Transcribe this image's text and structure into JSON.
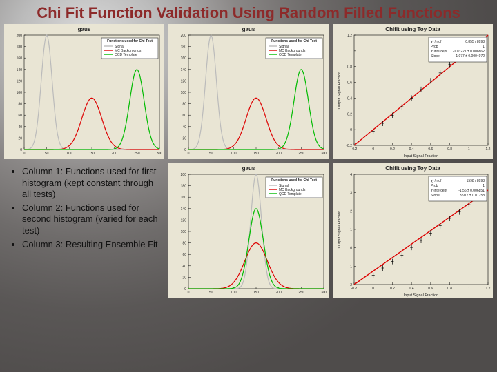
{
  "title": "Chi Fit Function Validation Using Random Filled Functions",
  "bullets": [
    "Column 1: Functions used for first histogram (kept constant through all tests)",
    "Column 2: Functions used for second histogram (varied for each test)",
    "Column 3: Resulting Ensemble Fit"
  ],
  "gaus_legend": {
    "title": "Functions used for Chi Test",
    "items": [
      "Signal",
      "MC Backgrounds",
      "QCD Template"
    ]
  },
  "chart_data": [
    {
      "id": "p1",
      "type": "line",
      "title": "gaus",
      "xlim": [
        0,
        300
      ],
      "ylim": [
        0,
        200
      ],
      "xticks": [
        0,
        50,
        100,
        150,
        200,
        250,
        300
      ],
      "yticks": [
        0,
        20,
        40,
        60,
        80,
        100,
        120,
        140,
        160,
        180,
        200
      ],
      "series": [
        {
          "name": "Signal",
          "color": "#bbb",
          "mu": 50,
          "sigma": 12,
          "amp": 200
        },
        {
          "name": "MC Backgrounds",
          "color": "#d00",
          "mu": 150,
          "sigma": 22,
          "amp": 90
        },
        {
          "name": "QCD Template",
          "color": "#0b0",
          "mu": 250,
          "sigma": 16,
          "amp": 140
        }
      ]
    },
    {
      "id": "p2",
      "type": "line",
      "title": "gaus",
      "xlim": [
        0,
        300
      ],
      "ylim": [
        0,
        200
      ],
      "xticks": [
        0,
        50,
        100,
        150,
        200,
        250,
        300
      ],
      "yticks": [
        0,
        20,
        40,
        60,
        80,
        100,
        120,
        140,
        160,
        180,
        200
      ],
      "series": [
        {
          "name": "Signal",
          "color": "#bbb",
          "mu": 50,
          "sigma": 12,
          "amp": 200
        },
        {
          "name": "MC Backgrounds",
          "color": "#d00",
          "mu": 150,
          "sigma": 22,
          "amp": 90
        },
        {
          "name": "QCD Template",
          "color": "#0b0",
          "mu": 250,
          "sigma": 16,
          "amp": 140
        }
      ]
    },
    {
      "id": "p3",
      "type": "scatter",
      "title": "Chifit using Toy Data",
      "xlabel": "Input Signal Fraction",
      "ylabel": "Output Signal Fraction",
      "xlim": [
        -0.2,
        1.2
      ],
      "ylim": [
        -0.2,
        1.2
      ],
      "xticks": [
        -0.2,
        0,
        0.2,
        0.4,
        0.6,
        0.8,
        1,
        1.2
      ],
      "yticks": [
        -0.2,
        0,
        0.2,
        0.4,
        0.6,
        0.8,
        1,
        1.2
      ],
      "fit": {
        "slope": 1.077,
        "intercept": -0.03221
      },
      "points": [
        {
          "x": 0.0,
          "y": -0.02
        },
        {
          "x": 0.1,
          "y": 0.08
        },
        {
          "x": 0.2,
          "y": 0.18
        },
        {
          "x": 0.3,
          "y": 0.29
        },
        {
          "x": 0.4,
          "y": 0.4
        },
        {
          "x": 0.5,
          "y": 0.51
        },
        {
          "x": 0.6,
          "y": 0.62
        },
        {
          "x": 0.7,
          "y": 0.72
        },
        {
          "x": 0.8,
          "y": 0.83
        },
        {
          "x": 0.9,
          "y": 0.94
        },
        {
          "x": 1.0,
          "y": 1.05
        }
      ],
      "stats": [
        {
          "k": "χ² / ndf",
          "v": "0.855 / 8998"
        },
        {
          "k": "Prob",
          "v": "1"
        },
        {
          "k": "Y intercept",
          "v": "-0.03221 ± 0.008862"
        },
        {
          "k": "Slope",
          "v": "1.077 ± 0.0004072"
        }
      ]
    },
    {
      "id": "p5",
      "type": "line",
      "title": "gaus",
      "xlim": [
        0,
        300
      ],
      "ylim": [
        0,
        200
      ],
      "xticks": [
        0,
        50,
        100,
        150,
        200,
        250,
        300
      ],
      "yticks": [
        0,
        20,
        40,
        60,
        80,
        100,
        120,
        140,
        160,
        180,
        200
      ],
      "series": [
        {
          "name": "Signal",
          "color": "#bbb",
          "mu": 150,
          "sigma": 12,
          "amp": 200
        },
        {
          "name": "MC Backgrounds",
          "color": "#d00",
          "mu": 150,
          "sigma": 25,
          "amp": 80
        },
        {
          "name": "QCD Template",
          "color": "#0b0",
          "mu": 150,
          "sigma": 16,
          "amp": 140
        }
      ]
    },
    {
      "id": "p6",
      "type": "scatter",
      "title": "Chifit using Toy Data",
      "xlabel": "Input Signal Fraction",
      "ylabel": "Output Signal Fraction",
      "xlim": [
        -0.2,
        1.2
      ],
      "ylim": [
        -2,
        4
      ],
      "xticks": [
        -0.2,
        0,
        0.2,
        0.4,
        0.6,
        0.8,
        1,
        1.2
      ],
      "yticks": [
        -2,
        -1,
        0,
        1,
        2,
        3,
        4
      ],
      "fit": {
        "slope": 3.917,
        "intercept": -1.56
      },
      "points": [
        {
          "x": 0.0,
          "y": -1.5
        },
        {
          "x": 0.1,
          "y": -1.1
        },
        {
          "x": 0.2,
          "y": -0.75
        },
        {
          "x": 0.3,
          "y": -0.4
        },
        {
          "x": 0.4,
          "y": 0.02
        },
        {
          "x": 0.5,
          "y": 0.4
        },
        {
          "x": 0.6,
          "y": 0.8
        },
        {
          "x": 0.7,
          "y": 1.2
        },
        {
          "x": 0.8,
          "y": 1.6
        },
        {
          "x": 0.9,
          "y": 1.95
        },
        {
          "x": 1.0,
          "y": 2.35
        }
      ],
      "stats": [
        {
          "k": "χ² / ndf",
          "v": "1598 / 8998"
        },
        {
          "k": "Prob",
          "v": "1"
        },
        {
          "k": "Y-intercept",
          "v": "-1.56 ± 0.006851"
        },
        {
          "k": "Slope",
          "v": "3.917 ± 0.01758"
        }
      ]
    }
  ]
}
